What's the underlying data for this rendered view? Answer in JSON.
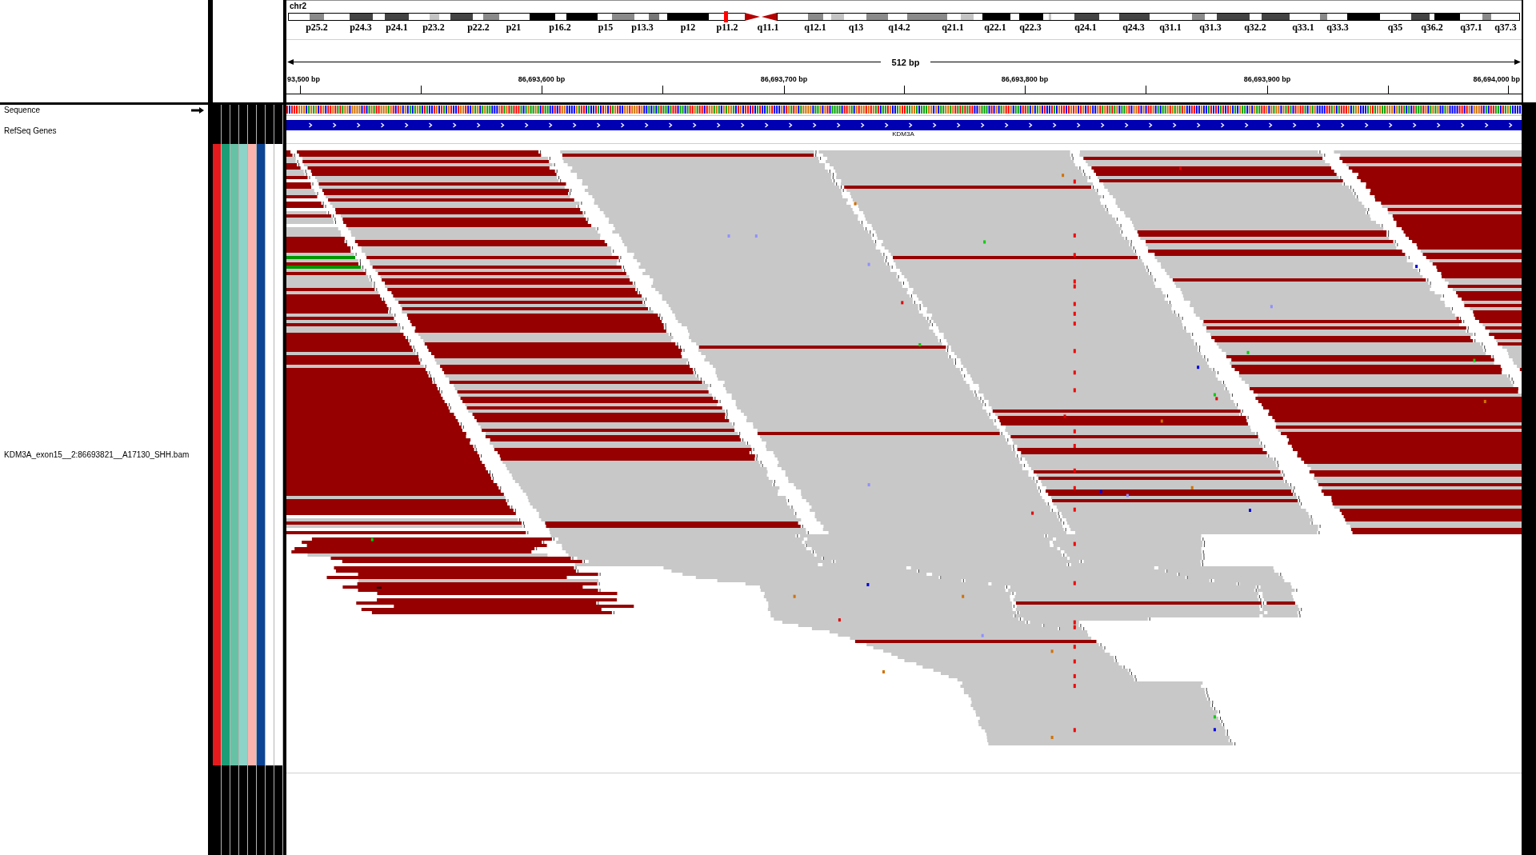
{
  "locus": {
    "chromosome": "chr2"
  },
  "ideogram": {
    "band_labels": [
      "p25.2",
      "p24.3",
      "p24.1",
      "p23.2",
      "p22.2",
      "p21",
      "p16.2",
      "p15",
      "p13.3",
      "p12",
      "p11.2",
      "q11.1",
      "q12.1",
      "q13",
      "q14.2",
      "q21.1",
      "q22.1",
      "q22.3",
      "q24.1",
      "q24.3",
      "q31.1",
      "q31.3",
      "q32.2",
      "q33.1",
      "q33.3",
      "q35",
      "q36.2",
      "q37.1",
      "q37.3"
    ]
  },
  "ruler": {
    "span": "512 bp",
    "tick_labels": [
      "93,500 bp",
      "86,693,600 bp",
      "86,693,700 bp",
      "86,693,800 bp",
      "86,693,900 bp",
      "86,694,000 bp"
    ]
  },
  "tracks": [
    {
      "kind": "sequence",
      "name": "Sequence",
      "forward_strand": true
    },
    {
      "kind": "gene",
      "name": "RefSeq Genes",
      "feature": "KDM3A"
    },
    {
      "kind": "alignment",
      "name": "KDM3A_exon15__2:86693821__A17130_SHH.bam",
      "attributes": [
        {
          "color": "#e41a1c"
        },
        {
          "color": "#1b9e77"
        },
        {
          "color": "#66c2a5"
        },
        {
          "color": "#8dd3c7"
        },
        {
          "color": "#fbb4ae"
        },
        {
          "color": "#0c4596"
        },
        {
          "color": "#ffffff"
        },
        {
          "color": "#ffffff"
        }
      ]
    }
  ]
}
